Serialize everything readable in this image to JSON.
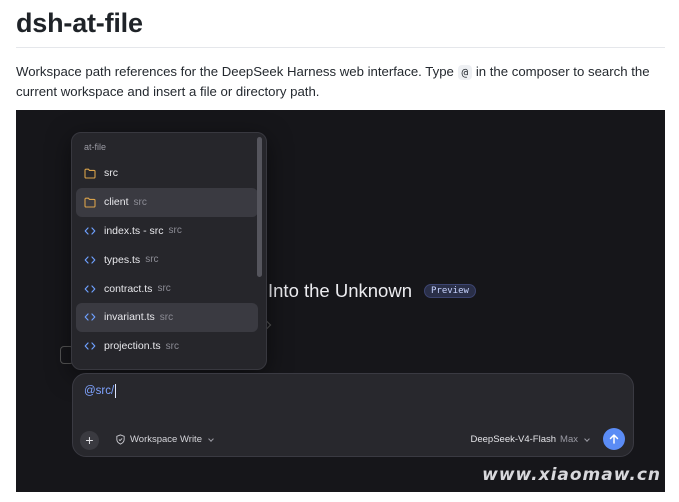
{
  "doc": {
    "title": "dsh-at-file",
    "desc_part1": "Workspace path references for the DeepSeek Harness web interface. Type ",
    "desc_code": "@",
    "desc_part2": " in the composer to search the current workspace and insert a file or directory path."
  },
  "hero": {
    "title": "Into the Unknown",
    "badge": "Preview"
  },
  "dropdown": {
    "heading": "at-file",
    "items": [
      {
        "icon": "folder-icon",
        "label": "src",
        "path": "",
        "active": false
      },
      {
        "icon": "folder-icon",
        "label": "client",
        "path": "src",
        "active": true
      },
      {
        "icon": "code-file-icon",
        "label": "index.ts - src",
        "path": "src",
        "active": false
      },
      {
        "icon": "code-file-icon",
        "label": "types.ts",
        "path": "src",
        "active": false
      },
      {
        "icon": "code-file-icon",
        "label": "contract.ts",
        "path": "src",
        "active": false
      },
      {
        "icon": "code-file-icon",
        "label": "invariant.ts",
        "path": "src",
        "active": true
      },
      {
        "icon": "code-file-icon",
        "label": "projection.ts",
        "path": "src",
        "active": false
      }
    ]
  },
  "composer": {
    "input_value": "@src/",
    "add_icon": "plus-icon",
    "mode_label": "Workspace Write",
    "mode_icon": "shield-icon",
    "model_name": "DeepSeek-V4-Flash",
    "model_effort": "Max",
    "send_icon": "arrow-up-icon"
  },
  "colors": {
    "screen_bg": "#16161a",
    "panel_bg": "#26262b",
    "active_row": "#3a3a41",
    "folder": "#d9a24a",
    "code_icon": "#6ea0ff",
    "accent": "#5b8cf5"
  },
  "watermark": "www.xiaomaw.cn"
}
